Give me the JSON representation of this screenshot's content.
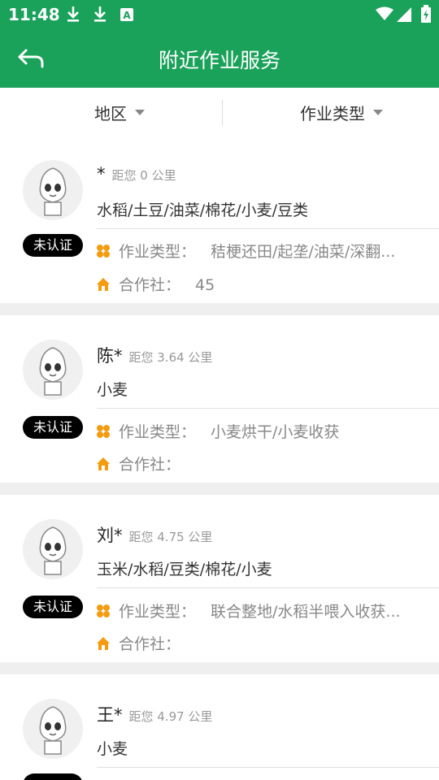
{
  "status_bar": {
    "time": "11:48",
    "icons": [
      "download-icon",
      "download-icon",
      "a-icon",
      "wifi-icon",
      "signal-icon",
      "battery-icon"
    ]
  },
  "app_bar": {
    "title": "附近作业服务",
    "back_icon": "back-arrow-icon"
  },
  "filters": {
    "region_label": "地区",
    "type_label": "作业类型"
  },
  "labels": {
    "work_type": "作业类型：",
    "coop": "合作社："
  },
  "providers": [
    {
      "name": "*",
      "distance": "距您 0 公里",
      "crops": "水稻/土豆/油菜/棉花/小麦/豆类",
      "badge": "未认证",
      "work_types": "秸梗还田/起垄/油菜/深翻...",
      "coop": "45"
    },
    {
      "name": "陈*",
      "distance": "距您 3.64 公里",
      "crops": "小麦",
      "badge": "未认证",
      "work_types": "小麦烘干/小麦收获",
      "coop": ""
    },
    {
      "name": "刘*",
      "distance": "距您 4.75 公里",
      "crops": "玉米/水稻/豆类/棉花/小麦",
      "badge": "未认证",
      "work_types": "联合整地/水稻半喂入收获...",
      "coop": ""
    },
    {
      "name": "王*",
      "distance": "距您 4.97 公里",
      "crops": "小麦",
      "badge": "",
      "work_types": "",
      "coop": ""
    }
  ],
  "colors": {
    "primary": "#1aa15a",
    "badge_bg": "#000000",
    "icon_orange": "#f39c12"
  }
}
